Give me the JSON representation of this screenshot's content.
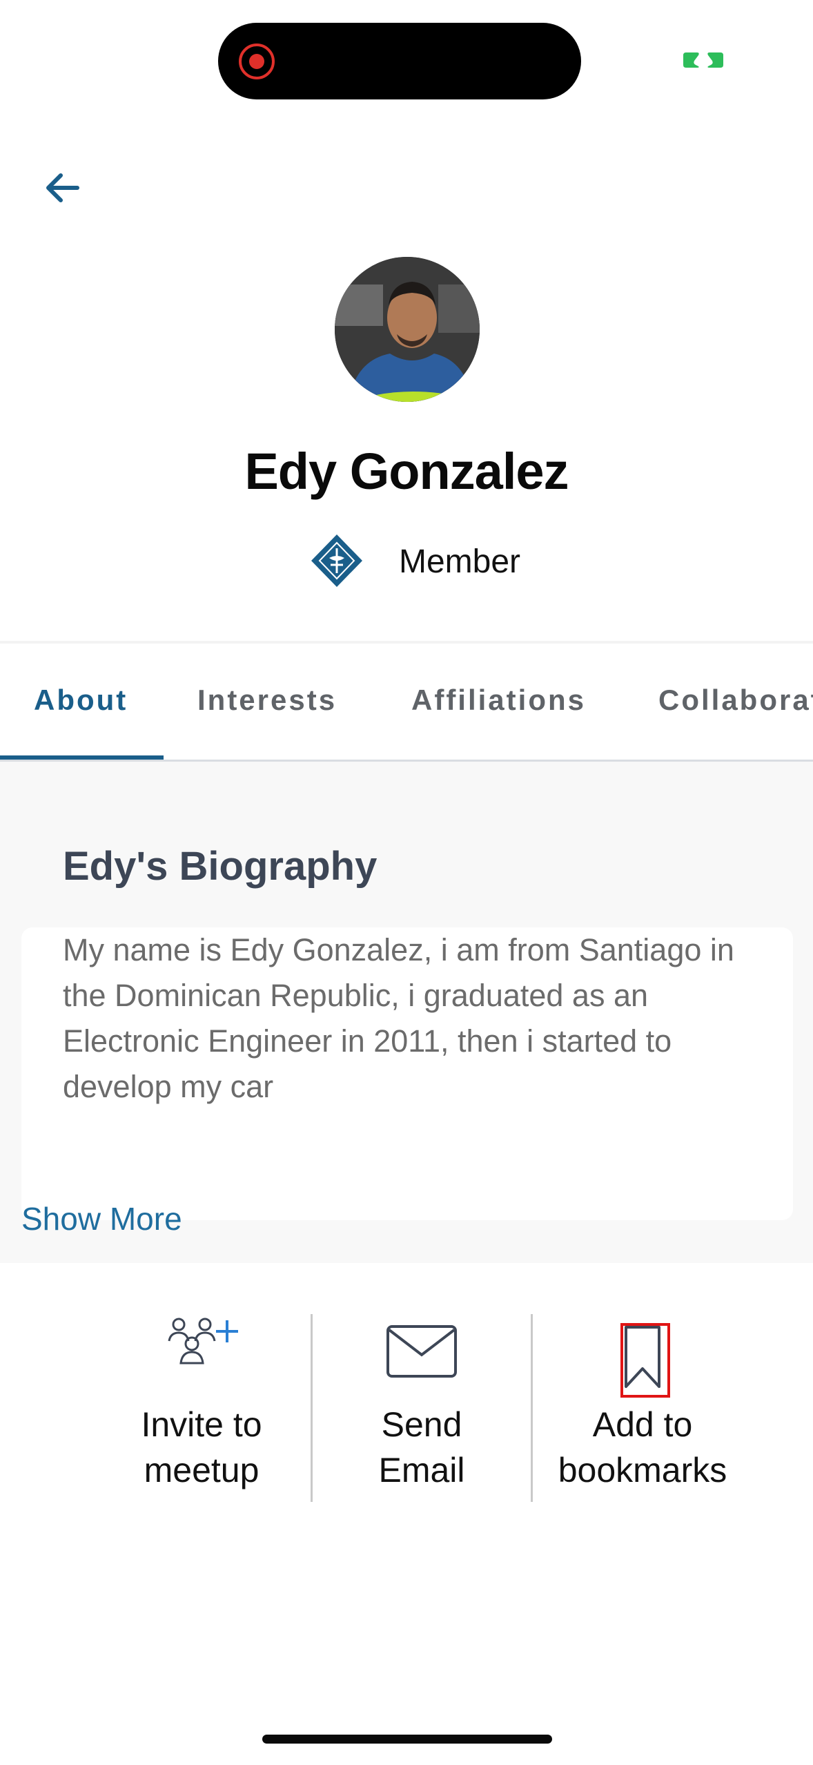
{
  "status_bar": {
    "recording_icon": "recording-dot-icon",
    "camera_indicator_icon": "camera-indicator-icon"
  },
  "header": {
    "back_icon": "arrow-left-icon"
  },
  "profile": {
    "name": "Edy Gonzalez",
    "role": "Member",
    "badge_icon": "member-diamond-icon"
  },
  "tabs": [
    {
      "label": "About",
      "active": true
    },
    {
      "label": "Interests",
      "active": false
    },
    {
      "label": "Affiliations",
      "active": false
    },
    {
      "label": "Collaborate",
      "active": false
    }
  ],
  "about": {
    "heading": "Edy's Biography",
    "biography": "My name is Edy Gonzalez, i am from Santiago in the Dominican Republic, i graduated as an Electronic Engineer in 2011, then i started to develop my car",
    "show_more": "Show More"
  },
  "actions": {
    "invite": {
      "label": "Invite to\nmeetup",
      "icon": "invite-group-icon"
    },
    "email": {
      "label": "Send\nEmail",
      "icon": "envelope-icon"
    },
    "bookmark": {
      "label": "Add to\nbookmarks",
      "icon": "bookmark-icon"
    }
  },
  "colors": {
    "accent": "#1a5e8a",
    "link": "#1f6d9e",
    "heading": "#3d4656",
    "highlight": "#e01515"
  }
}
